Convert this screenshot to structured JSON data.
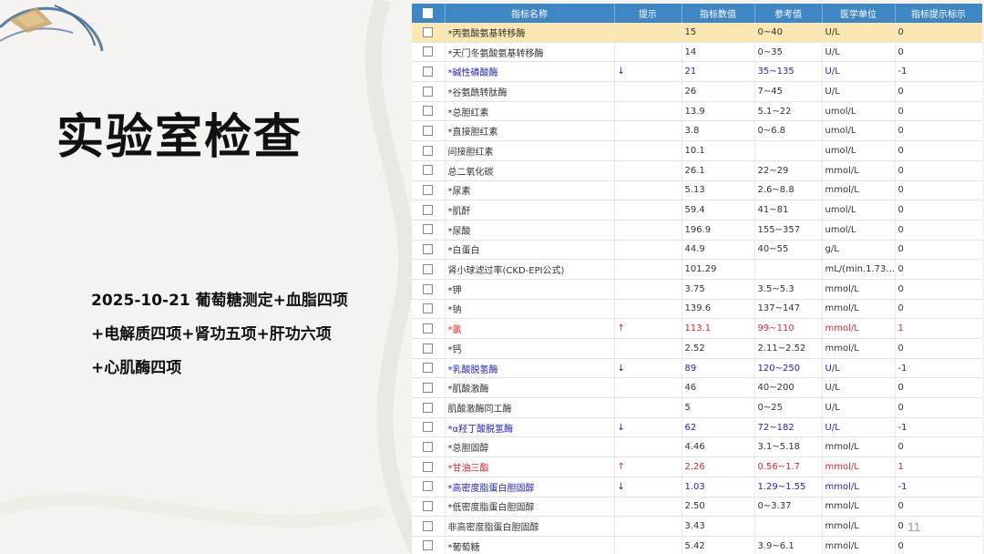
{
  "slide": {
    "title": "实验室检查",
    "subtitle_lines": [
      "2025-10-21  葡萄糖测定+血脂四项",
      "+电解质四项+肾功五项+肝功六项",
      "+心肌酶四项"
    ],
    "page_number": "11"
  },
  "table": {
    "headers": [
      "指标名称",
      "提示",
      "指标数值",
      "参考值",
      "医学单位",
      "指标提示标示"
    ],
    "rows": [
      {
        "name": "*丙氨酸氨基转移酶",
        "flag": "",
        "value": "15",
        "ref": "0~40",
        "unit": "U/L",
        "mark": "0",
        "style": "hl"
      },
      {
        "name": "*天门冬氨酸氨基转移酶",
        "flag": "",
        "value": "14",
        "ref": "0~35",
        "unit": "U/L",
        "mark": "0",
        "style": ""
      },
      {
        "name": "*碱性磷酸酶",
        "flag": "↓",
        "value": "21",
        "ref": "35~135",
        "unit": "U/L",
        "mark": "-1",
        "style": "low"
      },
      {
        "name": "*谷氨酰转肽酶",
        "flag": "",
        "value": "26",
        "ref": "7~45",
        "unit": "U/L",
        "mark": "0",
        "style": ""
      },
      {
        "name": "*总胆红素",
        "flag": "",
        "value": "13.9",
        "ref": "5.1~22",
        "unit": "umol/L",
        "mark": "0",
        "style": ""
      },
      {
        "name": "*直接胆红素",
        "flag": "",
        "value": "3.8",
        "ref": "0~6.8",
        "unit": "umol/L",
        "mark": "0",
        "style": ""
      },
      {
        "name": "间接胆红素",
        "flag": "",
        "value": "10.1",
        "ref": "",
        "unit": "umol/L",
        "mark": "0",
        "style": ""
      },
      {
        "name": "总二氧化碳",
        "flag": "",
        "value": "26.1",
        "ref": "22~29",
        "unit": "mmol/L",
        "mark": "0",
        "style": ""
      },
      {
        "name": "*尿素",
        "flag": "",
        "value": "5.13",
        "ref": "2.6~8.8",
        "unit": "mmol/L",
        "mark": "0",
        "style": ""
      },
      {
        "name": "*肌酐",
        "flag": "",
        "value": "59.4",
        "ref": "41~81",
        "unit": "umol/L",
        "mark": "0",
        "style": ""
      },
      {
        "name": "*尿酸",
        "flag": "",
        "value": "196.9",
        "ref": "155~357",
        "unit": "umol/L",
        "mark": "0",
        "style": ""
      },
      {
        "name": "*白蛋白",
        "flag": "",
        "value": "44.9",
        "ref": "40~55",
        "unit": "g/L",
        "mark": "0",
        "style": ""
      },
      {
        "name": "肾小球滤过率(CKD-EPI公式)",
        "flag": "",
        "value": "101.29",
        "ref": "",
        "unit": "mL/(min.1.73...",
        "mark": "0",
        "style": ""
      },
      {
        "name": "*钾",
        "flag": "",
        "value": "3.75",
        "ref": "3.5~5.3",
        "unit": "mmol/L",
        "mark": "0",
        "style": ""
      },
      {
        "name": "*钠",
        "flag": "",
        "value": "139.6",
        "ref": "137~147",
        "unit": "mmol/L",
        "mark": "0",
        "style": ""
      },
      {
        "name": "*氯",
        "flag": "↑",
        "value": "113.1",
        "ref": "99~110",
        "unit": "mmol/L",
        "mark": "1",
        "style": "high"
      },
      {
        "name": "*钙",
        "flag": "",
        "value": "2.52",
        "ref": "2.11~2.52",
        "unit": "mmol/L",
        "mark": "0",
        "style": ""
      },
      {
        "name": "*乳酸脱氢酶",
        "flag": "↓",
        "value": "89",
        "ref": "120~250",
        "unit": "U/L",
        "mark": "-1",
        "style": "low"
      },
      {
        "name": "*肌酸激酶",
        "flag": "",
        "value": "46",
        "ref": "40~200",
        "unit": "U/L",
        "mark": "0",
        "style": ""
      },
      {
        "name": "肌酸激酶同工酶",
        "flag": "",
        "value": "5",
        "ref": "0~25",
        "unit": "U/L",
        "mark": "0",
        "style": ""
      },
      {
        "name": "*α羟丁酸脱氢酶",
        "flag": "↓",
        "value": "62",
        "ref": "72~182",
        "unit": "U/L",
        "mark": "-1",
        "style": "low"
      },
      {
        "name": "*总胆固醇",
        "flag": "",
        "value": "4.46",
        "ref": "3.1~5.18",
        "unit": "mmol/L",
        "mark": "0",
        "style": ""
      },
      {
        "name": "*甘油三酯",
        "flag": "↑",
        "value": "2.26",
        "ref": "0.56~1.7",
        "unit": "mmol/L",
        "mark": "1",
        "style": "high"
      },
      {
        "name": "*高密度脂蛋白胆固醇",
        "flag": "↓",
        "value": "1.03",
        "ref": "1.29~1.55",
        "unit": "mmol/L",
        "mark": "-1",
        "style": "low"
      },
      {
        "name": "*低密度脂蛋白胆固醇",
        "flag": "",
        "value": "2.50",
        "ref": "0~3.37",
        "unit": "mmol/L",
        "mark": "0",
        "style": ""
      },
      {
        "name": "非高密度脂蛋白胆固醇",
        "flag": "",
        "value": "3.43",
        "ref": "",
        "unit": "mmol/L",
        "mark": "0",
        "style": ""
      },
      {
        "name": "*葡萄糖",
        "flag": "",
        "value": "5.42",
        "ref": "3.9~6.1",
        "unit": "mmol/L",
        "mark": "0",
        "style": ""
      }
    ]
  }
}
